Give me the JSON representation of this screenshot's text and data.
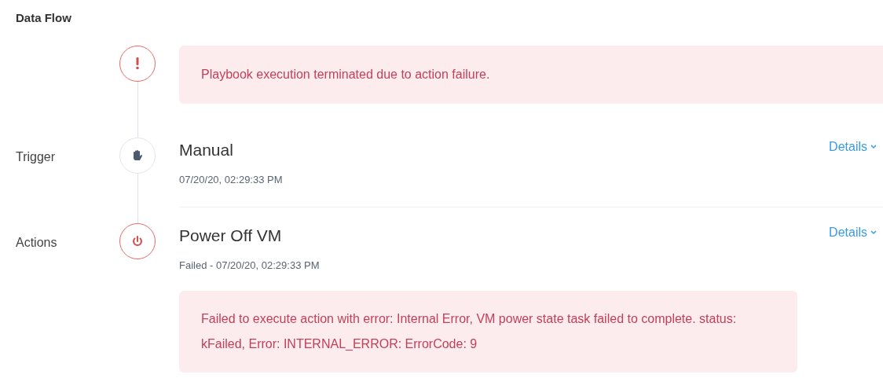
{
  "title": "Data Flow",
  "steps": [
    {
      "kind": "alert",
      "message": "Playbook execution terminated due to action failure."
    },
    {
      "kind": "trigger",
      "label": "Trigger",
      "name": "Manual",
      "time": "07/20/20, 02:29:33 PM",
      "details": "Details"
    },
    {
      "kind": "action",
      "label": "Actions",
      "name": "Power Off VM",
      "time": "Failed - 07/20/20, 02:29:33 PM",
      "details": "Details",
      "error": "Failed to execute action with error: Internal Error, VM power state task failed to complete. status: kFailed, Error: INTERNAL_ERROR: ErrorCode: 9"
    }
  ]
}
